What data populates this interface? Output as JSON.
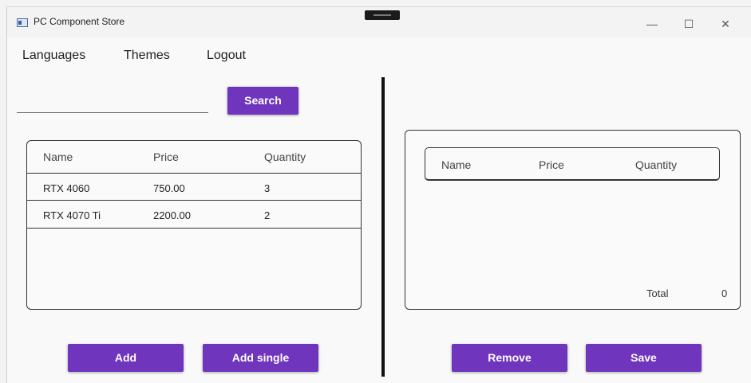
{
  "window": {
    "title": "PC Component Store",
    "controls": {
      "minimize": "—",
      "maximize": "☐",
      "close": "✕"
    }
  },
  "menu": {
    "items": [
      "Languages",
      "Themes",
      "Logout"
    ]
  },
  "search": {
    "value": "",
    "button_label": "Search"
  },
  "left_table": {
    "columns": [
      "Name",
      "Price",
      "Quantity"
    ],
    "rows": [
      {
        "name": "RTX 4060",
        "price": "750.00",
        "quantity": "3"
      },
      {
        "name": "RTX 4070 Ti",
        "price": "2200.00",
        "quantity": "2"
      }
    ]
  },
  "right_table": {
    "columns": [
      "Name",
      "Price",
      "Quantity"
    ],
    "rows": []
  },
  "total": {
    "label": "Total",
    "value": "0"
  },
  "buttons": {
    "add": "Add",
    "add_single": "Add single",
    "remove": "Remove",
    "save": "Save"
  },
  "colors": {
    "accent": "#6f35bd"
  }
}
